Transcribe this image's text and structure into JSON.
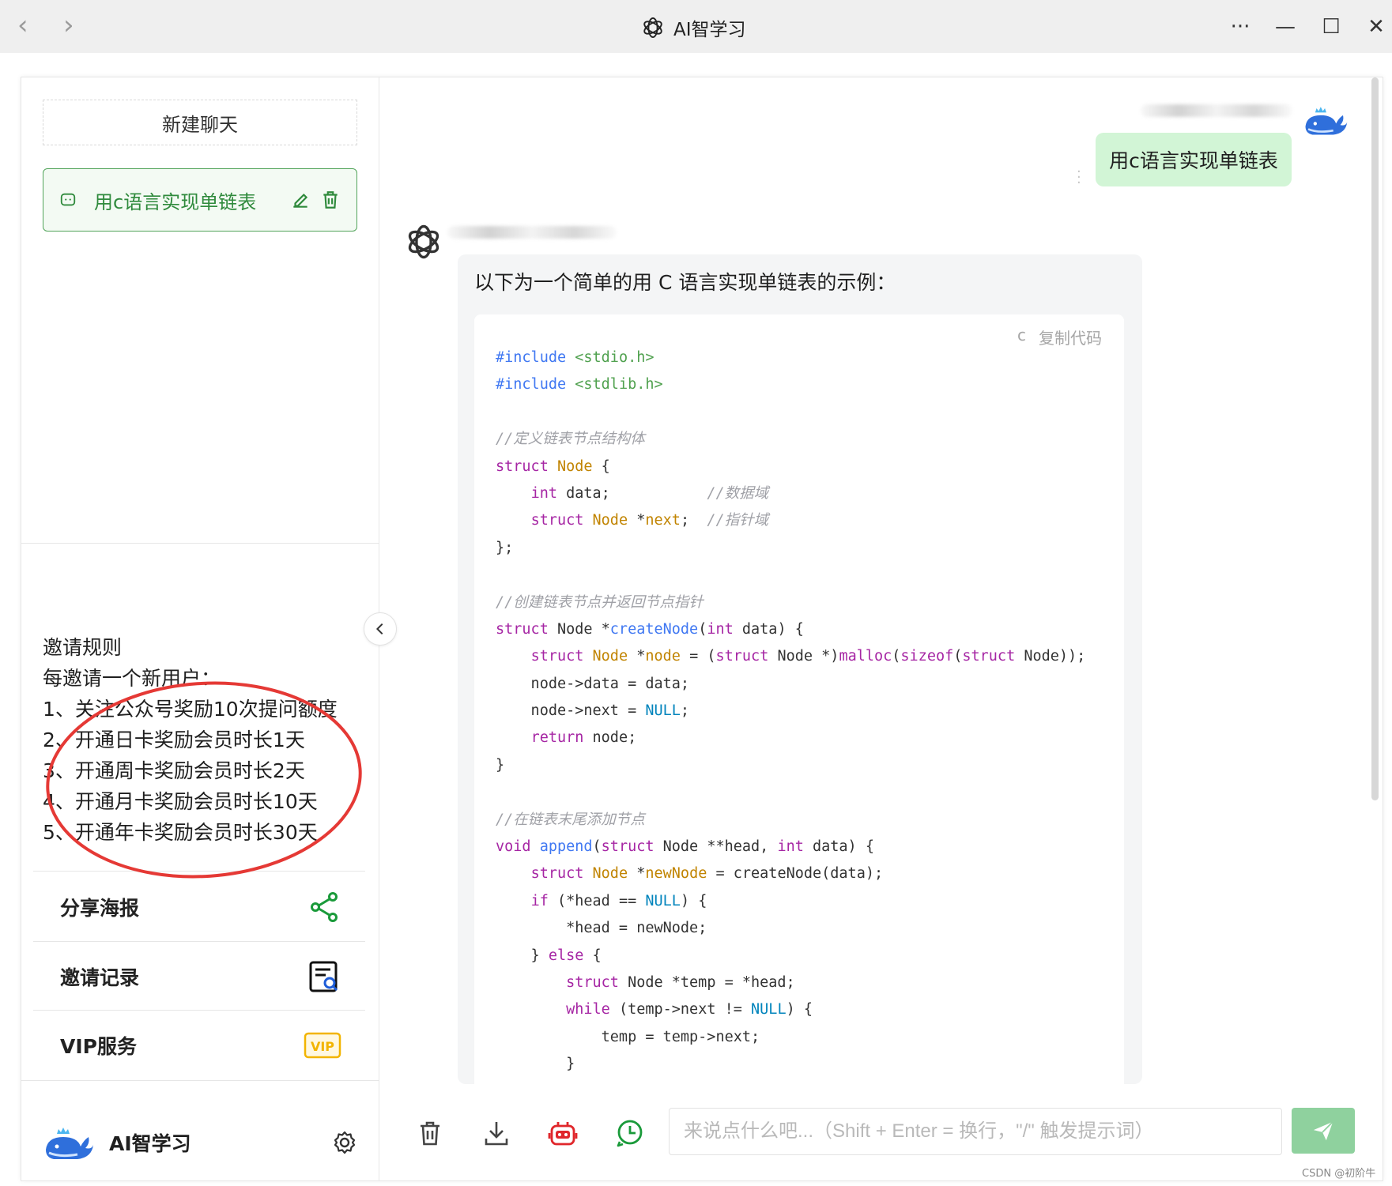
{
  "window": {
    "title": "AI智学习",
    "nav_back": "‹",
    "nav_forward": "›",
    "more": "···",
    "minimize": "—",
    "maximize": "☐",
    "close": "✕"
  },
  "sidebar": {
    "new_chat_label": "新建聊天",
    "chats": [
      {
        "label": "用c语言实现单链表",
        "active": true,
        "icon": "chat-bubble-icon"
      }
    ],
    "invite_title": "邀请规则",
    "invite_lines": [
      "每邀请一个新用户：",
      "1、关注公众号奖励10次提问额度",
      "2、开通日卡奖励会员时长1天",
      "3、开通周卡奖励会员时长2天",
      "4、开通月卡奖励会员时长10天",
      "5、开通年卡奖励会员时长30天"
    ],
    "menu": [
      {
        "label": "分享海报",
        "icon": "share-icon"
      },
      {
        "label": "邀请记录",
        "icon": "invite-record-icon"
      },
      {
        "label": "VIP服务",
        "icon": "vip-icon",
        "badge": "VIP"
      }
    ],
    "footer_app_name": "AI智学习"
  },
  "chat": {
    "user_message": "用c语言实现单链表",
    "bot_intro": "以下为一个简单的用 C 语言实现单链表的示例：",
    "code_lang": "c",
    "copy_code_label": "复制代码"
  },
  "input": {
    "placeholder": "来说点什么吧...（Shift + Enter = 换行，\"/\" 触发提示词）"
  },
  "watermark": "CSDN @初阶牛",
  "colors": {
    "accent": "#52a45a",
    "user_bubble": "#d2f5d6",
    "send_button": "#8fd19e",
    "annotation": "#e53935",
    "vip": "#f2b400"
  }
}
